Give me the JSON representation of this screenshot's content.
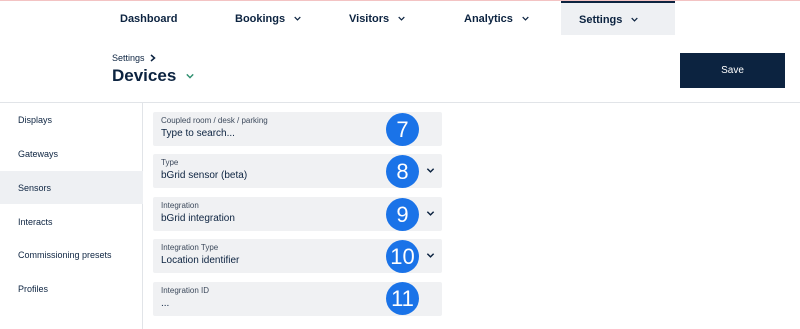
{
  "nav": {
    "items": [
      {
        "label": "Dashboard"
      },
      {
        "label": "Bookings"
      },
      {
        "label": "Visitors"
      },
      {
        "label": "Analytics"
      },
      {
        "label": "Settings"
      }
    ]
  },
  "header": {
    "breadcrumb": "Settings",
    "title": "Devices",
    "save_label": "Save"
  },
  "sidebar": {
    "items": [
      {
        "label": "Displays"
      },
      {
        "label": "Gateways"
      },
      {
        "label": "Sensors"
      },
      {
        "label": "Interacts"
      },
      {
        "label": "Commissioning presets"
      },
      {
        "label": "Profiles"
      }
    ]
  },
  "form": {
    "fields": [
      {
        "label": "Coupled room / desk / parking",
        "value": "Type to search...",
        "badge": "7"
      },
      {
        "label": "Type",
        "value": "bGrid sensor (beta)",
        "badge": "8"
      },
      {
        "label": "Integration",
        "value": "bGrid integration",
        "badge": "9"
      },
      {
        "label": "Integration Type",
        "value": "Location identifier",
        "badge": "10"
      },
      {
        "label": "Integration ID",
        "value": "...",
        "badge": "11"
      }
    ]
  },
  "colors": {
    "brand": "#0c2340",
    "badge": "#1a73e8",
    "field_bg": "#f0f1f3",
    "active_bg": "#eef0f3"
  }
}
